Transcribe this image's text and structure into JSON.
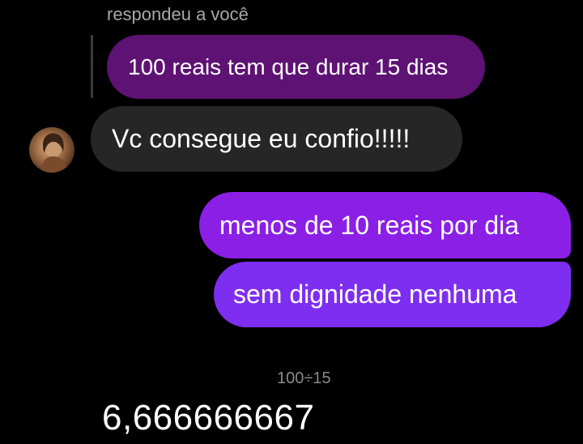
{
  "reply": {
    "caption": "respondeu a você",
    "quoted_text": "100 reais tem que durar 15 dias"
  },
  "incoming": {
    "text": "Vc consegue eu confio!!!!!",
    "avatar_icon": "profile-photo-icon"
  },
  "outgoing": [
    {
      "text": "menos de 10 reais por dia"
    },
    {
      "text": "sem dignidade nenhuma"
    }
  ],
  "calculator": {
    "expression": "100÷15",
    "result": "6,666666667"
  },
  "colors": {
    "background": "#000000",
    "quoted_bubble": "#5e1273",
    "incoming_bubble": "#262626",
    "outgoing_bubble_1": "#8b1fe6",
    "outgoing_bubble_2": "#7e2ef0",
    "caption_text": "#a8a8a8",
    "calc_expression_text": "#8a8a8a"
  }
}
